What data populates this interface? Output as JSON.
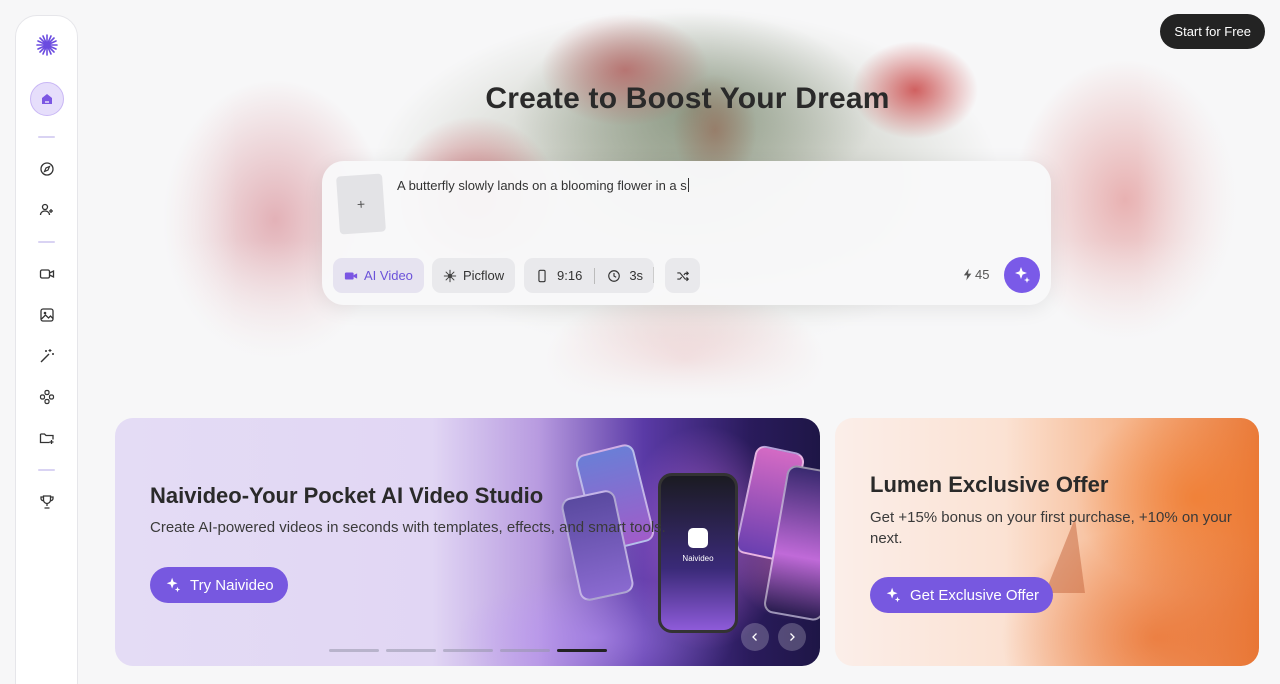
{
  "header": {
    "start_label": "Start for Free"
  },
  "sidebar": {
    "items": [
      {
        "name": "logo",
        "icon": "sparkle-logo-icon"
      },
      {
        "name": "home",
        "icon": "home-icon",
        "active": true
      },
      {
        "name": "explore",
        "icon": "compass-icon"
      },
      {
        "name": "community",
        "icon": "users-icon"
      },
      {
        "name": "video",
        "icon": "video-icon"
      },
      {
        "name": "image",
        "icon": "image-icon"
      },
      {
        "name": "magic",
        "icon": "magic-wand-icon"
      },
      {
        "name": "tools",
        "icon": "grid-icon"
      },
      {
        "name": "assets",
        "icon": "folder-icon"
      },
      {
        "name": "rewards",
        "icon": "trophy-icon"
      }
    ]
  },
  "hero": {
    "title": "Create to Boost Your Dream"
  },
  "prompt": {
    "upload_symbol": "+",
    "text": "A butterfly slowly lands on a blooming flower in a s",
    "mode_label": "AI Video",
    "model_label": "Picflow",
    "ratio_label": "9:16",
    "duration_label": "3s",
    "credits": "45"
  },
  "banners": {
    "main": {
      "title": "Naivideo-Your Pocket AI Video Studio",
      "subtitle": "Create AI-powered videos in seconds with templates, effects, and smart tools.",
      "button_label": "Try Naivideo",
      "phone_label": "Naivideo",
      "slide_count": 5,
      "active_slide": 5
    },
    "offer": {
      "title": "Lumen Exclusive Offer",
      "subtitle": "Get +15% bonus on your first purchase, +10% on your next.",
      "button_label": "Get Exclusive Offer"
    }
  },
  "colors": {
    "accent": "#7758e0",
    "dark_button": "#232323"
  }
}
